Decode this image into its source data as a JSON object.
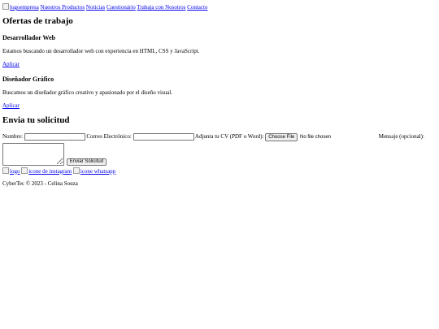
{
  "nav": {
    "logo_alt": "logoempresa",
    "links": [
      "Nuestros Productos",
      "Noticias",
      "Cuestionário",
      "Trabaja con Nosotros",
      "Contacto"
    ]
  },
  "jobs": {
    "title": "Ofertas de trabajo",
    "items": [
      {
        "title": "Desarrollador Web",
        "description": "Estamos buscando un desarrollador web con experiencia en HTML, CSS y JavaScript.",
        "apply_label": "Aplicar"
      },
      {
        "title": "Diseñador Gráfico",
        "description": "Buscamos un diseñador gráfico creativo y apasionado por el diseño visual.",
        "apply_label": "Aplicar"
      }
    ]
  },
  "form": {
    "title": "Envia tu solicitud",
    "name_label": "Nombre:",
    "name_value": "",
    "email_label": "Correo Electrónico:",
    "email_value": "",
    "cv_label": "Adjunta tu CV (PDF o Word):",
    "file_button": "Choose File",
    "file_status": "No file chosen",
    "message_label": "Mensaje (opcional):",
    "message_value": "",
    "submit_label": "Enviar Solicitud"
  },
  "footer": {
    "logo_alt": "logo",
    "instagram_alt": "icone de instagram",
    "whatsapp_alt": "icone whatsapp",
    "copyright": "CyberTec © 2023 - Celina Souza"
  }
}
